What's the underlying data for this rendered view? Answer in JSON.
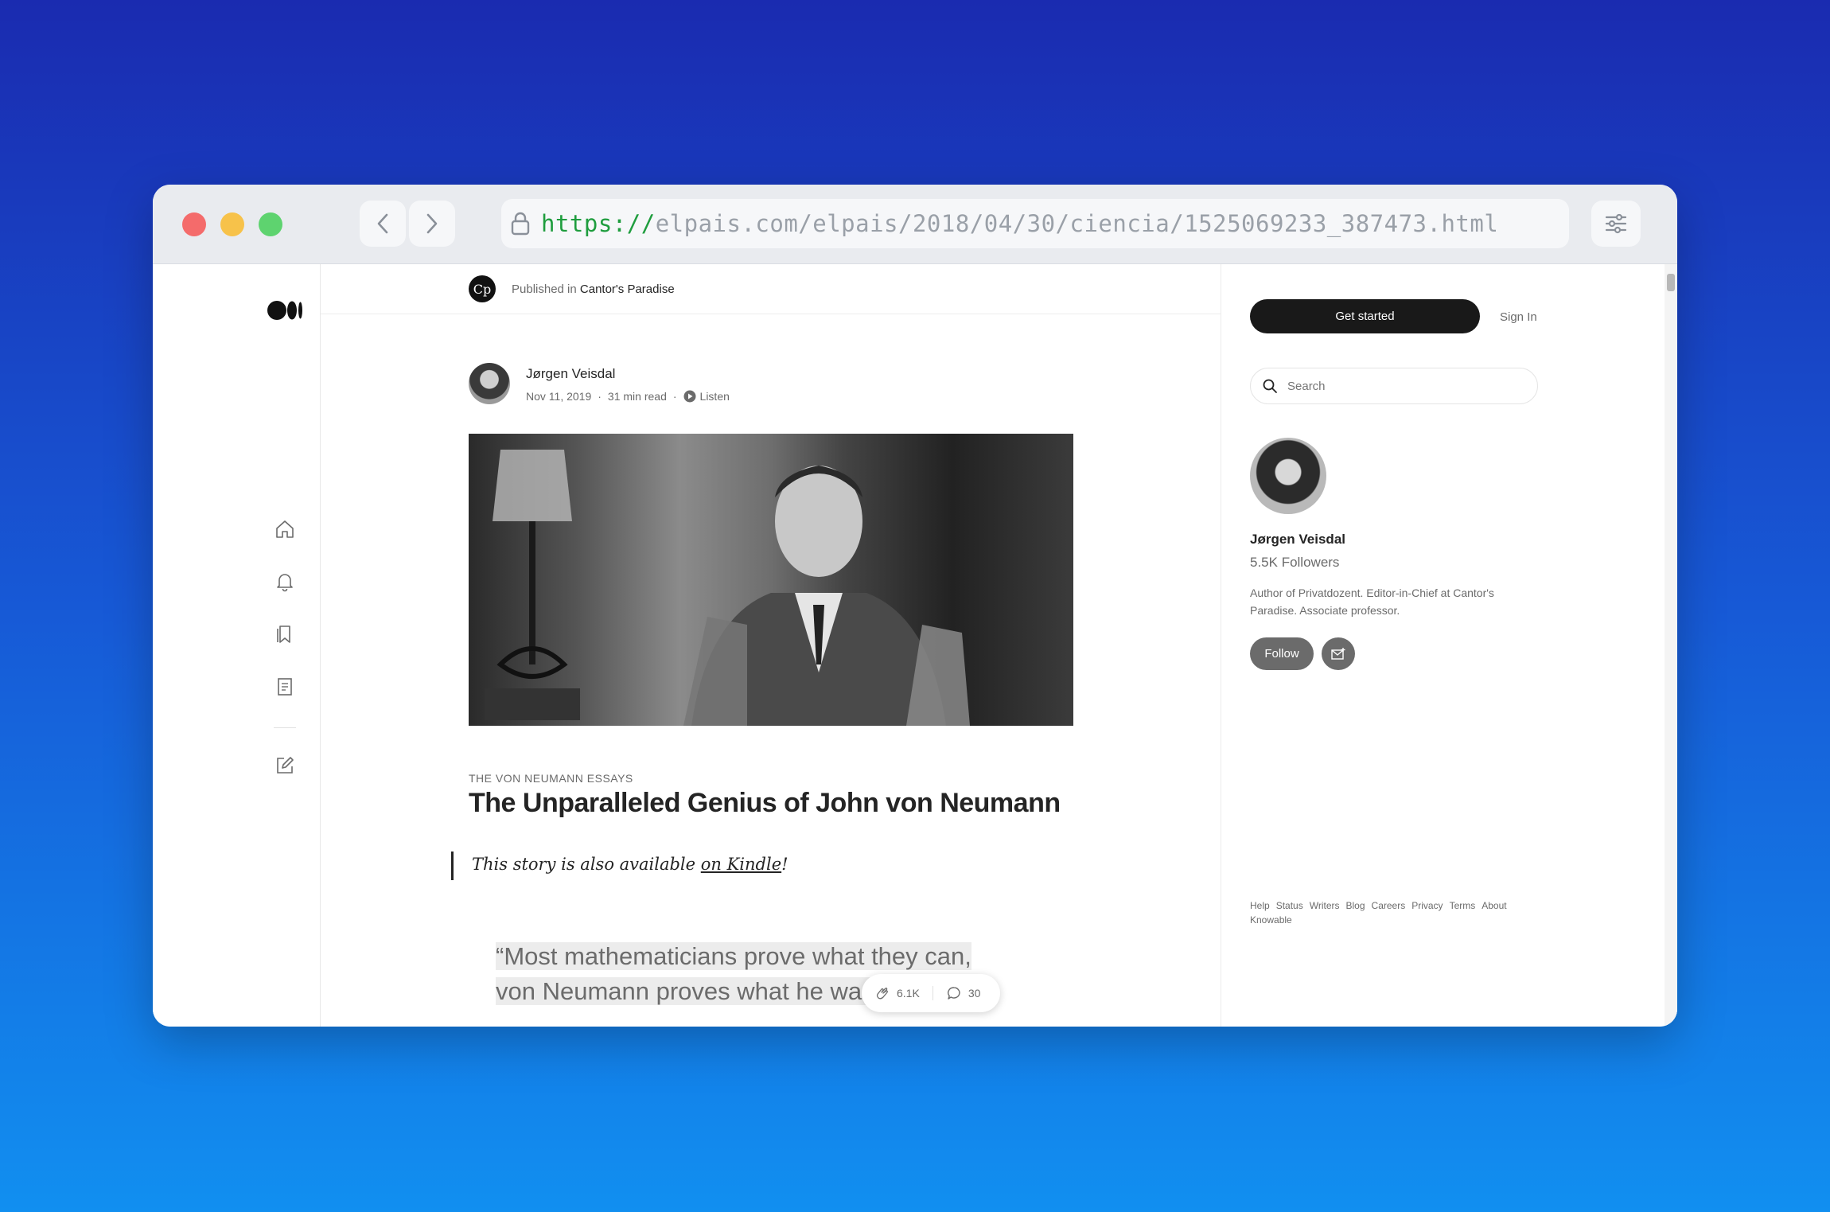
{
  "browser": {
    "url_scheme": "https://",
    "url_rest": "elpais.com/elpais/2018/04/30/ciencia/1525069233_387473.html"
  },
  "publication": {
    "published_in": "Published in",
    "name": "Cantor's Paradise",
    "logo_text": "Cp"
  },
  "article": {
    "author": "Jørgen Veisdal",
    "date": "Nov 11, 2019",
    "read_time": "31 min read",
    "listen_label": "Listen",
    "kicker": "THE VON NEUMANN ESSAYS",
    "title": "The Unparalleled Genius of John von Neumann",
    "kindle_prefix": "This story is also available ",
    "kindle_link": "on Kindle",
    "kindle_suffix": "!",
    "quote": "“Most mathematicians prove what they can, von Neumann proves what he wants”"
  },
  "actions": {
    "claps": "6.1K",
    "responses": "30"
  },
  "sidebar_right": {
    "get_started": "Get started",
    "sign_in": "Sign In",
    "search_placeholder": "Search",
    "profile_name": "Jørgen Veisdal",
    "followers": "5.5K Followers",
    "bio": "Author of Privatdozent. Editor-in-Chief at Cantor's Paradise. Associate professor.",
    "follow": "Follow",
    "footer_links": [
      "Help",
      "Status",
      "Writers",
      "Blog",
      "Careers",
      "Privacy",
      "Terms",
      "About",
      "Knowable"
    ]
  },
  "colors": {
    "accent_dark": "#191919",
    "url_scheme": "#1f9d3e"
  }
}
